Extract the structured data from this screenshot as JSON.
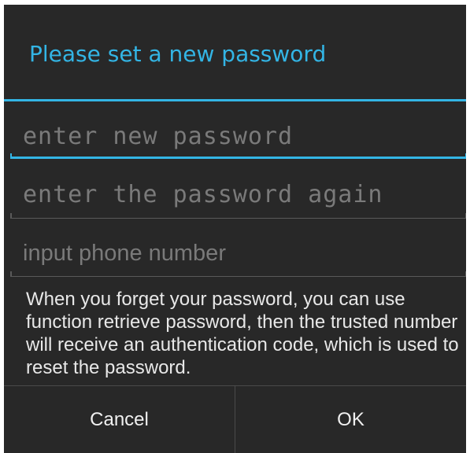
{
  "dialog": {
    "title": "Please set a new password",
    "fields": [
      {
        "placeholder": "enter new password",
        "focused": true
      },
      {
        "placeholder": "enter the password again",
        "focused": false
      },
      {
        "placeholder": "input phone number",
        "focused": false
      }
    ],
    "info_text": "When you forget your password, you can use function retrieve password, then the trusted number will receive an authentication code, which is used to reset the password.",
    "buttons": {
      "cancel": "Cancel",
      "ok": "OK"
    }
  },
  "colors": {
    "accent": "#33b5e5",
    "dialog_background": "#282828",
    "hint_text": "#7a7a7a",
    "body_text": "#e8e8e8"
  }
}
